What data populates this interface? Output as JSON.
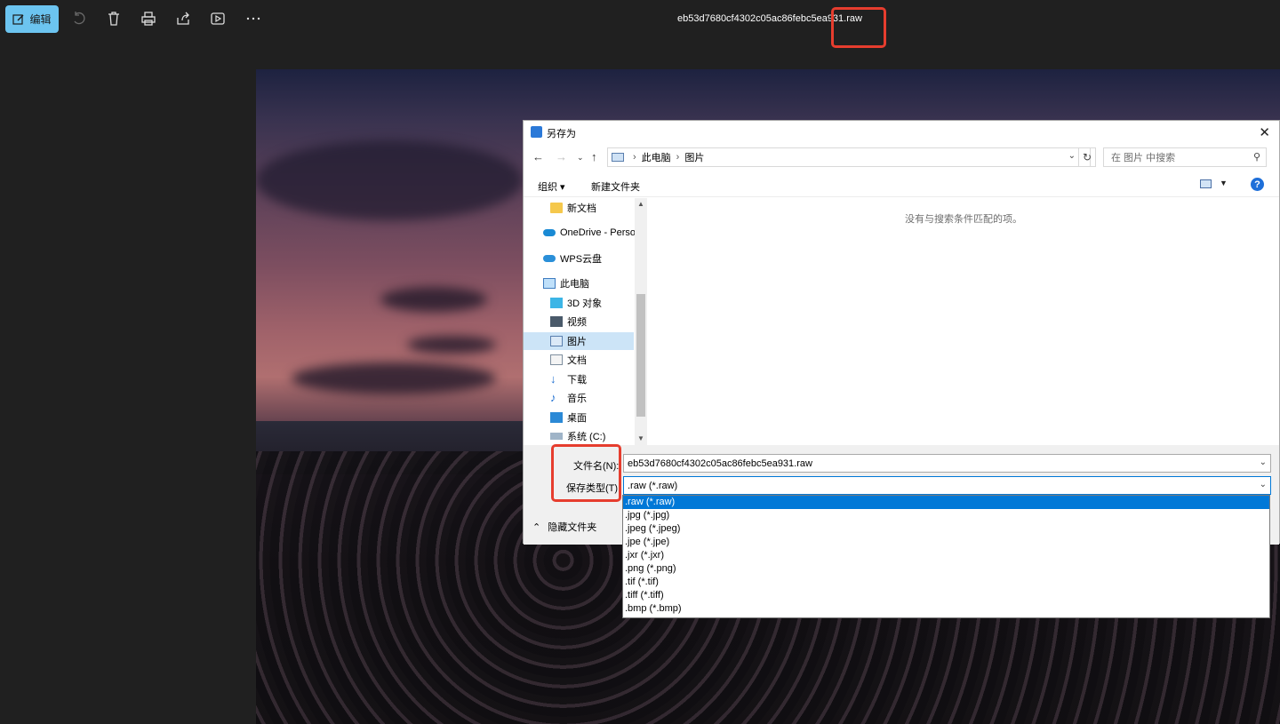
{
  "toolbar": {
    "edit_label": "编辑",
    "title": "eb53d7680cf4302c05ac86febc5ea931.raw"
  },
  "dialog": {
    "title": "另存为",
    "breadcrumb": [
      "此电脑",
      "图片"
    ],
    "search_placeholder": "在 图片 中搜索",
    "organize_label": "组织 ▾",
    "new_folder_label": "新建文件夹",
    "empty_message": "没有与搜索条件匹配的项。",
    "nav_items": [
      {
        "label": "新文档",
        "icon": "folder-icon"
      },
      {
        "label": "OneDrive - Perso",
        "icon": "onedrive-icon"
      },
      {
        "label": "WPS云盘",
        "icon": "cloud-icon"
      },
      {
        "label": "此电脑",
        "icon": "computer-icon"
      },
      {
        "label": "3D 对象",
        "icon": "3d-objects-icon"
      },
      {
        "label": "视频",
        "icon": "video-icon"
      },
      {
        "label": "图片",
        "icon": "pictures-icon"
      },
      {
        "label": "文档",
        "icon": "documents-icon"
      },
      {
        "label": "下载",
        "icon": "download-icon"
      },
      {
        "label": "音乐",
        "icon": "music-icon"
      },
      {
        "label": "桌面",
        "icon": "desktop-icon"
      },
      {
        "label": "系统 (C:)",
        "icon": "drive-icon"
      }
    ],
    "filename_label": "文件名(N):",
    "filename_value": "eb53d7680cf4302c05ac86febc5ea931.raw",
    "filetype_label": "保存类型(T):",
    "filetype_value": ".raw (*.raw)",
    "hide_folders_label": "隐藏文件夹"
  },
  "filetype_options": [
    ".raw (*.raw)",
    ".jpg (*.jpg)",
    ".jpeg (*.jpeg)",
    ".jpe (*.jpe)",
    ".jxr (*.jxr)",
    ".png (*.png)",
    ".tif (*.tif)",
    ".tiff (*.tiff)",
    ".bmp (*.bmp)"
  ],
  "colors": {
    "accent": "#0078d7",
    "edit_button": "#6cc4f0",
    "highlight_box": "#e63d2e",
    "app_background": "#202020"
  }
}
